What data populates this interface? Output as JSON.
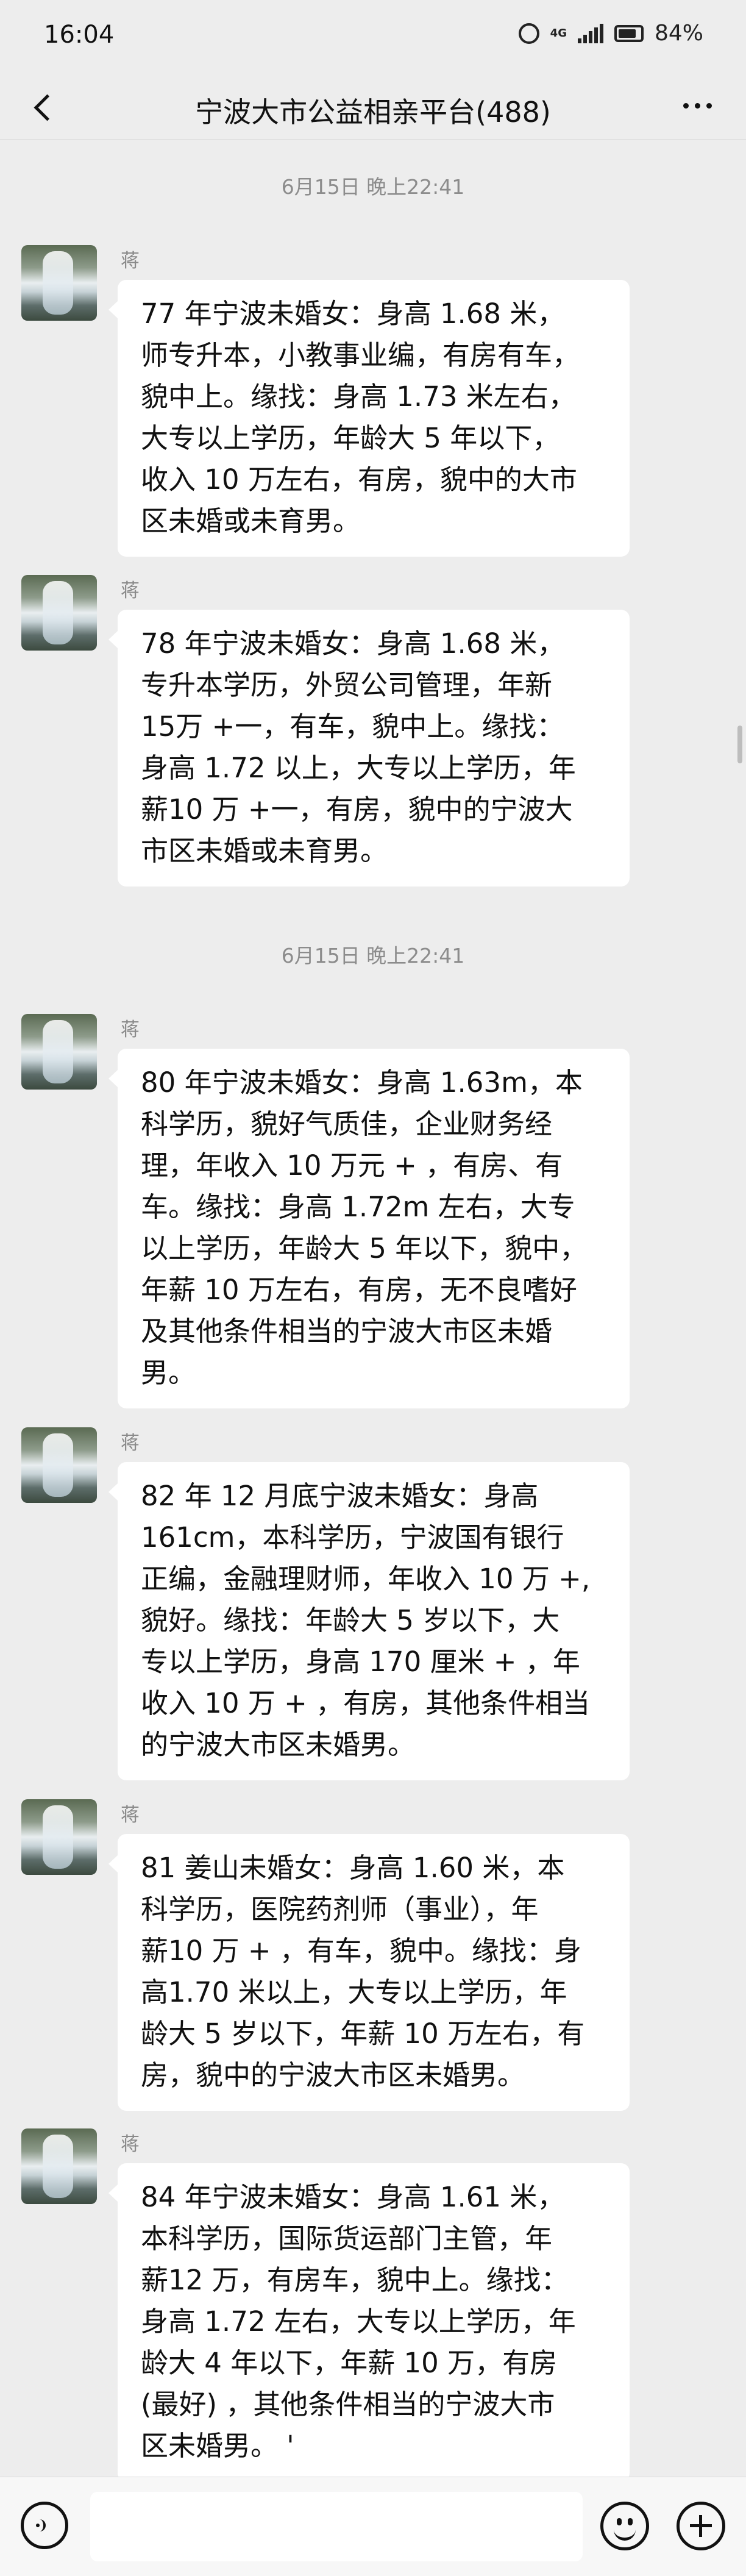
{
  "status_bar": {
    "time": "16:04",
    "battery": "84%",
    "network": "4G"
  },
  "header": {
    "title": "宁波大市公益相亲平台(488)"
  },
  "timestamps": [
    "6月15日 晚上22:41",
    "6月15日 晚上22:41"
  ],
  "messages": [
    {
      "sender": "蒋",
      "text": "77 年宁波未婚女：身高 1.68 米，\n师专升本，小教事业编，有房有车，\n貌中上。缘找：身高 1.73 米左右，\n大专以上学历，年龄大 5 年以下，\n收入 10 万左右，有房，貌中的大市\n区未婚或未育男。"
    },
    {
      "sender": "蒋",
      "text": "78 年宁波未婚女：身高 1.68 米，\n专升本学历，外贸公司管理，年新\n15万 +一，有车，貌中上。缘找：\n身高 1.72 以上，大专以上学历，年\n薪10 万 +一，有房，貌中的宁波大\n市区未婚或未育男。"
    },
    {
      "sender": "蒋",
      "text": "80 年宁波未婚女：身高 1.63m，本\n科学历，貌好气质佳，企业财务经\n理，年收入 10 万元 + ，有房、有\n车。缘找：身高 1.72m 左右，大专\n以上学历，年龄大 5 年以下，貌中，\n年薪 10 万左右，有房，无不良嗜好\n及其他条件相当的宁波大市区未婚\n男。"
    },
    {
      "sender": "蒋",
      "text": "82 年 12 月底宁波未婚女：身高\n161cm，本科学历，宁波国有银行\n正编，金融理财师，年收入 10 万 +,\n貌好。缘找：年龄大 5 岁以下，大\n专以上学历，身高 170 厘米 + ，年\n收入 10 万 + ，有房，其他条件相当\n的宁波大市区未婚男。"
    },
    {
      "sender": "蒋",
      "text": "81 姜山未婚女：身高 1.60 米，本\n科学历，医院药剂师（事业），年\n薪10 万 + ，有车，貌中。缘找：身\n高1.70 米以上，大专以上学历，年\n龄大 5 岁以下，年薪 10 万左右，有\n房，貌中的宁波大市区未婚男。"
    },
    {
      "sender": "蒋",
      "text": "84 年宁波未婚女：身高 1.61 米，\n本科学历，国际货运部门主管，年\n薪12 万，有房车，貌中上。缘找：\n身高 1.72 左右，大专以上学历，年\n龄大 4 年以下，年薪 10 万，有房\n(最好) ，其他条件相当的宁波大市\n区未婚男。 '"
    }
  ],
  "icons": {
    "back": "chevron-left-icon",
    "more": "more-dots-icon",
    "voice": "voice-icon",
    "emoji": "emoji-icon",
    "plus": "plus-icon"
  },
  "colors": {
    "background": "#ededed",
    "bubble": "#ffffff",
    "timestamp": "#8c8c8c"
  }
}
